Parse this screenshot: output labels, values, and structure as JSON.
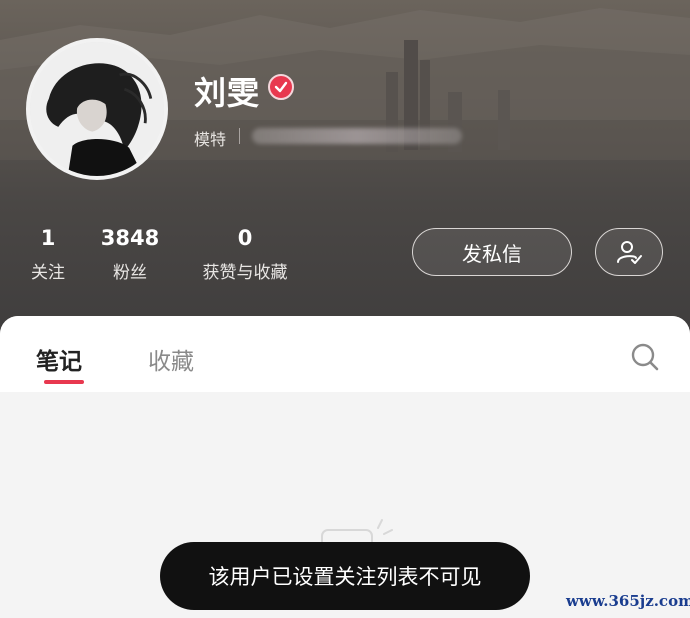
{
  "profile": {
    "name": "刘雯",
    "profession": "模特",
    "verified_icon": "verified-check-icon"
  },
  "stats": [
    {
      "value": "1",
      "label": "关注"
    },
    {
      "value": "3848",
      "label": "粉丝"
    },
    {
      "value": "0",
      "label": "获赞与收藏"
    }
  ],
  "actions": {
    "message_label": "发私信",
    "follow_icon": "user-check-icon"
  },
  "tabs": [
    {
      "label": "笔记",
      "active": true
    },
    {
      "label": "收藏",
      "active": false
    }
  ],
  "search_icon": "search-icon",
  "toast": "该用户已设置关注列表不可见",
  "watermark": "www.365jz.com",
  "colors": {
    "accent": "#e8384f",
    "toast_bg": "#111111"
  }
}
